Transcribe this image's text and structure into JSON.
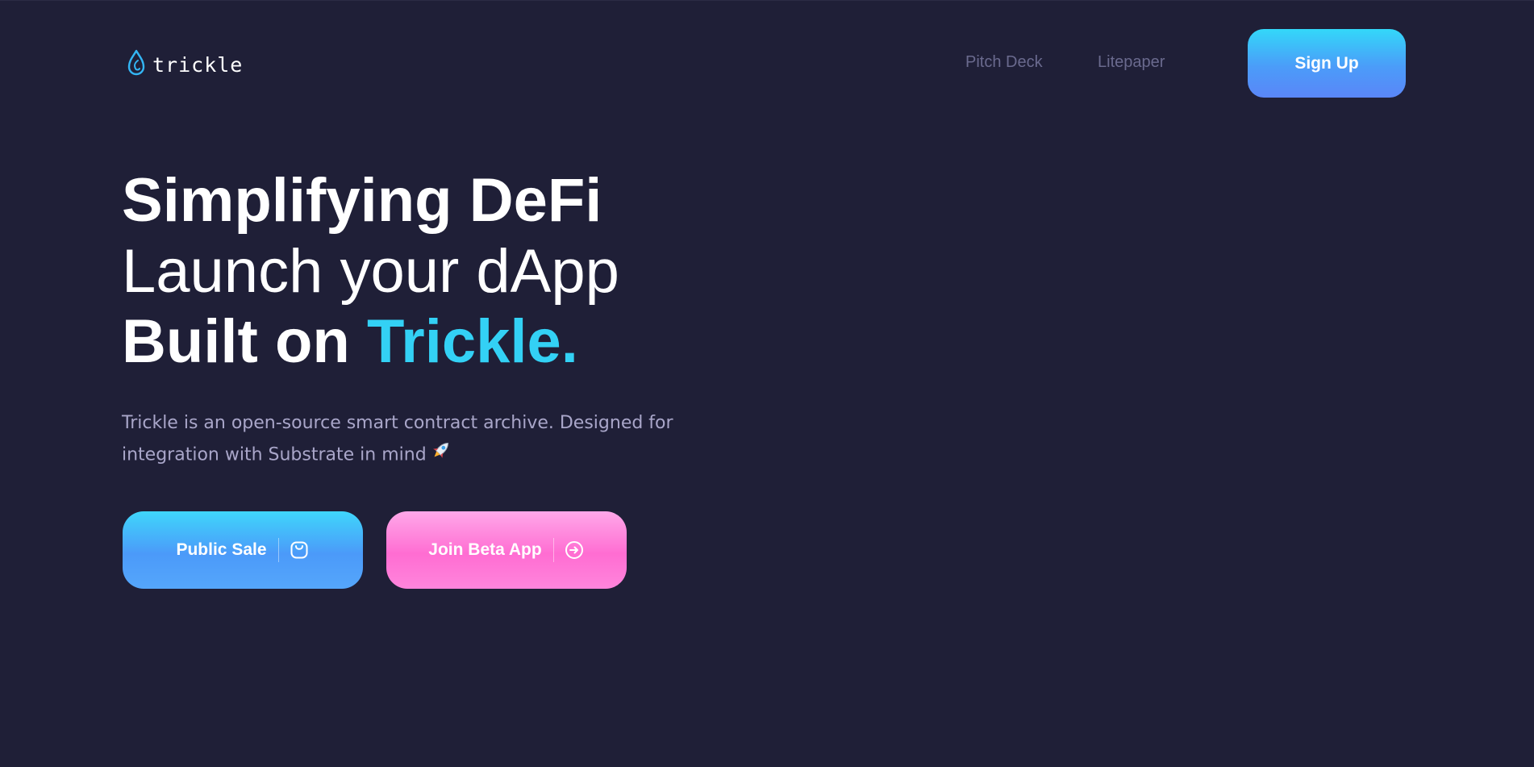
{
  "header": {
    "logo_text": "trickle",
    "nav": {
      "pitch_deck": "Pitch Deck",
      "litepaper": "Litepaper"
    },
    "signup_label": "Sign Up"
  },
  "hero": {
    "line1": "Simplifying DeFi",
    "line2": "Launch your dApp",
    "line3_prefix": "Built on ",
    "line3_accent": "Trickle.",
    "subtitle": "Trickle is an open-source smart contract archive. Designed for integration with Substrate in mind"
  },
  "buttons": {
    "public_sale": "Public Sale",
    "join_beta": "Join Beta App"
  },
  "icons": {
    "logo": "water-drop-icon",
    "rocket": "rocket-icon",
    "public_sale": "shopping-bag-icon",
    "join_beta": "arrow-circle-right-icon"
  },
  "colors": {
    "background": "#1f1f37",
    "accent": "#33d1f5",
    "blue_button": "#4b9af9",
    "pink_button": "#ff6dd2",
    "nav_text": "#6a6a8e",
    "subtitle_text": "#a9a6c9"
  }
}
